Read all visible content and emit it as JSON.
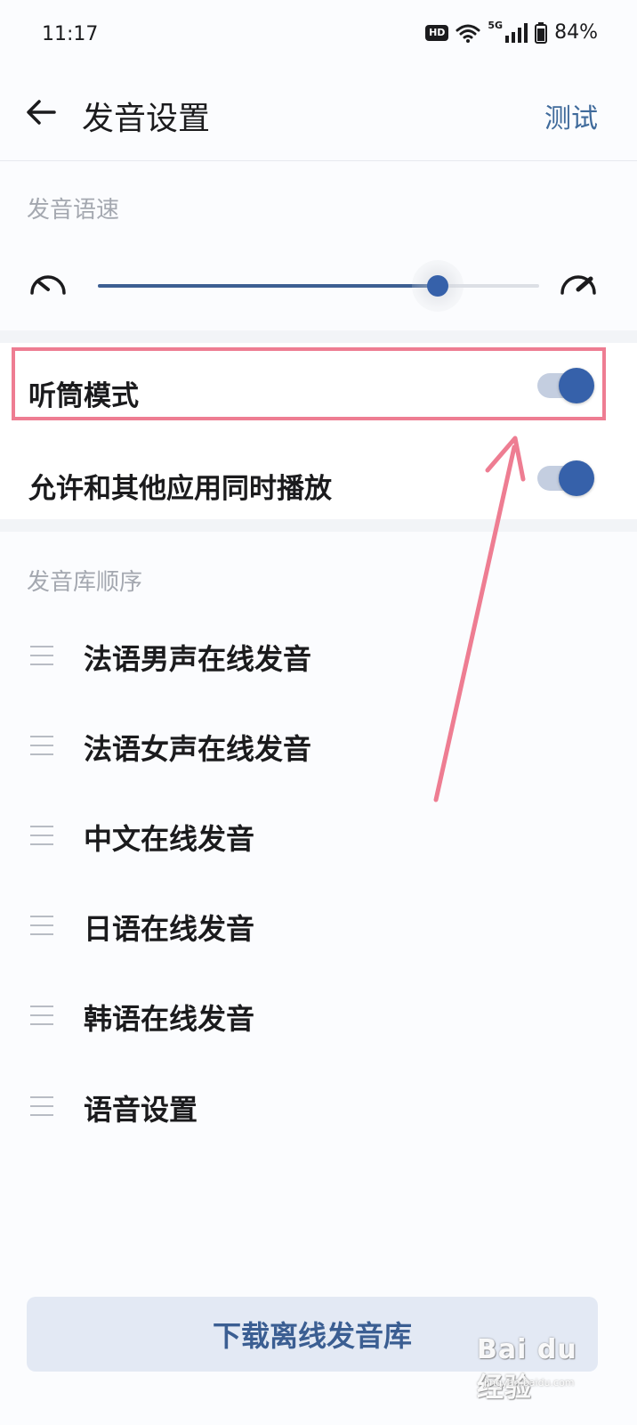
{
  "status_bar": {
    "time": "11:17",
    "hd_badge": "HD",
    "network_label": "5G",
    "battery": "84%",
    "icons": [
      "wifi-icon",
      "signal-icon",
      "battery-icon"
    ]
  },
  "header": {
    "title": "发音设置",
    "action": "测试",
    "back_icon": "arrow-left-icon"
  },
  "speed": {
    "section_label": "发音语速",
    "slider_value": 0.77,
    "slow_icon": "gauge-slow-icon",
    "fast_icon": "gauge-fast-icon"
  },
  "toggles": [
    {
      "label": "听筒模式",
      "on": true
    },
    {
      "label": "允许和其他应用同时播放",
      "on": true
    }
  ],
  "engine_order": {
    "section_label": "发音库顺序",
    "items": [
      {
        "label": "法语男声在线发音"
      },
      {
        "label": "法语女声在线发音"
      },
      {
        "label": "中文在线发音"
      },
      {
        "label": "日语在线发音"
      },
      {
        "label": "韩语在线发音"
      },
      {
        "label": "语音设置"
      }
    ]
  },
  "download_button": {
    "label": "下载离线发音库"
  },
  "watermark": {
    "text": "Bai du 经验",
    "sub": "jingyan.baidu.com"
  },
  "colors": {
    "accent": "#3661aa",
    "link": "#3f6a9b",
    "annotation": "#ee7d92"
  }
}
